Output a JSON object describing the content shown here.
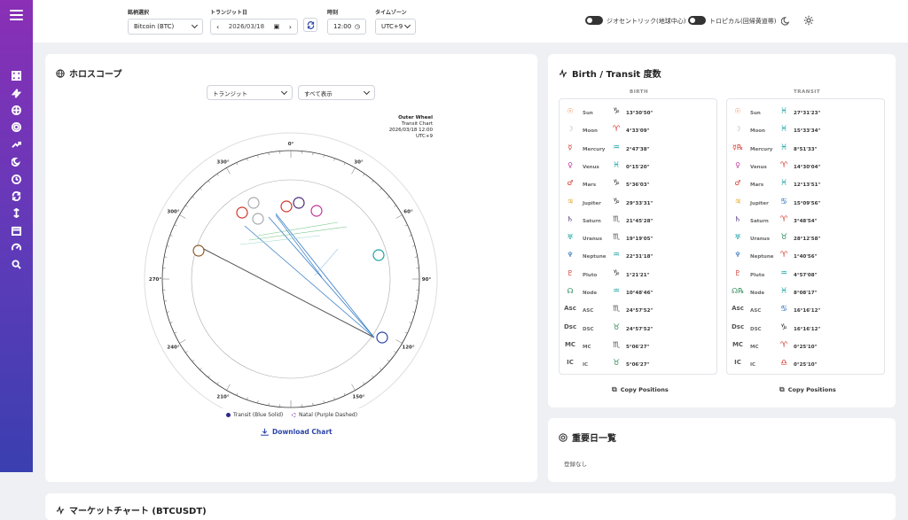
{
  "topbar": {
    "asset": {
      "label": "銘柄選択",
      "value": "Bitcoin (BTC)"
    },
    "transit_date": {
      "label": "トランジット日",
      "value": "2026/03/18"
    },
    "time": {
      "label": "時刻",
      "value": "12:00"
    },
    "timezone": {
      "label": "タイムゾーン",
      "value": "UTC+9"
    },
    "toggle_geo": "ジオセントリック(地球中心)",
    "toggle_tropical": "トロピカル(回帰黄道帯)"
  },
  "horoscope": {
    "title": "ホロスコープ",
    "mode_select": "トランジット",
    "filter_select": "すべて表示",
    "wheel_info": [
      "Outer Wheel",
      "Transit Chart",
      "2026/03/18 12:00",
      "UTC+9"
    ],
    "degree_labels": [
      "0°",
      "30°",
      "60°",
      "90°",
      "120°",
      "150°",
      "180°",
      "210°",
      "240°",
      "270°",
      "300°",
      "330°"
    ],
    "legend_transit": "Transit (Blue Solid)",
    "legend_natal": "Natal (Purple Dashed)",
    "download": "Download Chart"
  },
  "degrees_card": {
    "title": "Birth / Transit 度数",
    "birth_header": "BIRTH",
    "transit_header": "TRANSIT",
    "copy_label": "Copy Positions",
    "birth": [
      {
        "glyph": "☉",
        "color": "#e8742f",
        "name": "Sun",
        "sign": "♑",
        "sign_color": "#333",
        "deg": "13°30'50\""
      },
      {
        "glyph": "☽",
        "color": "#aaa",
        "name": "Moon",
        "sign": "♈",
        "sign_color": "#d0362a",
        "deg": "4°33'09\""
      },
      {
        "glyph": "☿",
        "color": "#d0362a",
        "name": "Mercury",
        "sign": "♒",
        "sign_color": "#1aa3a3",
        "deg": "2°47'38\""
      },
      {
        "glyph": "♀",
        "color": "#c2339c",
        "name": "Venus",
        "sign": "♓",
        "sign_color": "#1aa3a3",
        "deg": "0°15'20\""
      },
      {
        "glyph": "♂",
        "color": "#d0362a",
        "name": "Mars",
        "sign": "♑",
        "sign_color": "#333",
        "deg": "5°36'03\""
      },
      {
        "glyph": "♃",
        "color": "#e0a11b",
        "name": "Jupiter",
        "sign": "♑",
        "sign_color": "#333",
        "deg": "29°33'31\""
      },
      {
        "glyph": "♄",
        "color": "#4a2a7a",
        "name": "Saturn",
        "sign": "♏",
        "sign_color": "#555",
        "deg": "21°45'28\""
      },
      {
        "glyph": "♅",
        "color": "#1aa3a3",
        "name": "Uranus",
        "sign": "♏",
        "sign_color": "#555",
        "deg": "19°19'05\""
      },
      {
        "glyph": "♆",
        "color": "#2d6fb8",
        "name": "Neptune",
        "sign": "♒",
        "sign_color": "#1aa3a3",
        "deg": "22°31'18\""
      },
      {
        "glyph": "♇",
        "color": "#d0362a",
        "name": "Pluto",
        "sign": "♑",
        "sign_color": "#333",
        "deg": "1°21'21\""
      },
      {
        "glyph": "☊",
        "color": "#2a8a5a",
        "name": "Node",
        "sign": "♒",
        "sign_color": "#1aa3a3",
        "deg": "10°48'46\""
      },
      {
        "glyph": "Asc",
        "color": "#555",
        "name": "ASC",
        "sign": "♏",
        "sign_color": "#555",
        "deg": "24°57'52\""
      },
      {
        "glyph": "Dsc",
        "color": "#555",
        "name": "DSC",
        "sign": "♉",
        "sign_color": "#2a8a5a",
        "deg": "24°57'52\""
      },
      {
        "glyph": "MC",
        "color": "#555",
        "name": "MC",
        "sign": "♏",
        "sign_color": "#555",
        "deg": "5°06'27\""
      },
      {
        "glyph": "IC",
        "color": "#555",
        "name": "IC",
        "sign": "♉",
        "sign_color": "#2a8a5a",
        "deg": "5°06'27\""
      }
    ],
    "transit": [
      {
        "glyph": "☉",
        "color": "#e8742f",
        "name": "Sun",
        "sign": "♓",
        "sign_color": "#1aa3a3",
        "deg": "27°31'23\""
      },
      {
        "glyph": "☽",
        "color": "#aaa",
        "name": "Moon",
        "sign": "♓",
        "sign_color": "#1aa3a3",
        "deg": "15°33'34\""
      },
      {
        "glyph": "☿℞",
        "color": "#d0362a",
        "name": "Mercury",
        "sign": "♓",
        "sign_color": "#1aa3a3",
        "deg": "8°51'33\""
      },
      {
        "glyph": "♀",
        "color": "#c2339c",
        "name": "Venus",
        "sign": "♈",
        "sign_color": "#d0362a",
        "deg": "14°30'04\""
      },
      {
        "glyph": "♂",
        "color": "#d0362a",
        "name": "Mars",
        "sign": "♓",
        "sign_color": "#1aa3a3",
        "deg": "12°13'51\""
      },
      {
        "glyph": "♃",
        "color": "#e0a11b",
        "name": "Jupiter",
        "sign": "♋",
        "sign_color": "#2d6fb8",
        "deg": "15°09'56\""
      },
      {
        "glyph": "♄",
        "color": "#4a2a7a",
        "name": "Saturn",
        "sign": "♈",
        "sign_color": "#d0362a",
        "deg": "3°48'54\""
      },
      {
        "glyph": "♅",
        "color": "#1aa3a3",
        "name": "Uranus",
        "sign": "♉",
        "sign_color": "#2a8a5a",
        "deg": "28°12'58\""
      },
      {
        "glyph": "♆",
        "color": "#2d6fb8",
        "name": "Neptune",
        "sign": "♈",
        "sign_color": "#d0362a",
        "deg": "1°40'56\""
      },
      {
        "glyph": "♇",
        "color": "#d0362a",
        "name": "Pluto",
        "sign": "♒",
        "sign_color": "#1aa3a3",
        "deg": "4°57'08\""
      },
      {
        "glyph": "☊℞",
        "color": "#2a8a5a",
        "name": "Node",
        "sign": "♓",
        "sign_color": "#1aa3a3",
        "deg": "8°08'17\""
      },
      {
        "glyph": "Asc",
        "color": "#555",
        "name": "ASC",
        "sign": "♋",
        "sign_color": "#2d6fb8",
        "deg": "16°16'12\""
      },
      {
        "glyph": "Dsc",
        "color": "#555",
        "name": "DSC",
        "sign": "♑",
        "sign_color": "#333",
        "deg": "16°16'12\""
      },
      {
        "glyph": "MC",
        "color": "#555",
        "name": "MC",
        "sign": "♈",
        "sign_color": "#d0362a",
        "deg": "0°25'10\""
      },
      {
        "glyph": "IC",
        "color": "#555",
        "name": "IC",
        "sign": "♎",
        "sign_color": "#d0362a",
        "deg": "0°25'10\""
      }
    ]
  },
  "important_dates": {
    "title": "重要日一覧",
    "empty": "登録なし"
  },
  "market_chart": {
    "title": "マーケットチャート (BTCUSDT)"
  },
  "colors": {
    "accent": "#2d45a8",
    "sidebar_top": "#8a2fb6",
    "sidebar_bottom": "#3a3fb0"
  }
}
